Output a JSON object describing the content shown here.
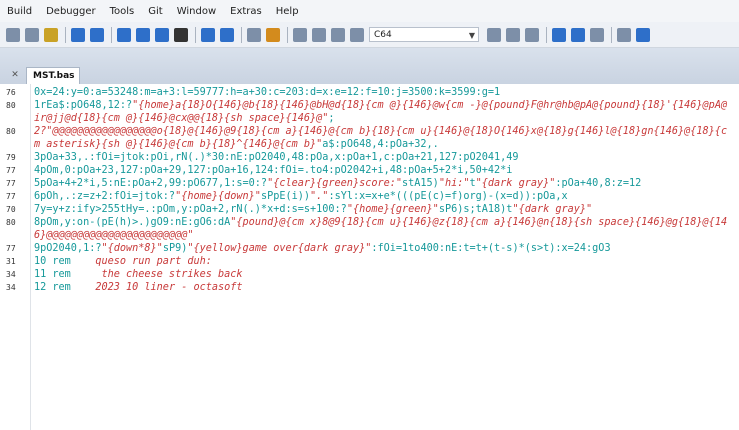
{
  "menubar": {
    "items": [
      "Build",
      "Debugger",
      "Tools",
      "Git",
      "Window",
      "Extras",
      "Help"
    ]
  },
  "toolbar": {
    "combo_value": "C64",
    "icons": [
      {
        "name": "cut-icon",
        "color": "#7d8fa8"
      },
      {
        "name": "copy-icon",
        "color": "#7d8fa8"
      },
      {
        "name": "paste-icon",
        "color": "#c9a227"
      },
      {
        "name": "list-icon",
        "color": "#2e6fc9"
      },
      {
        "name": "bulb-icon",
        "color": "#2e6fc9"
      },
      {
        "name": "run-icon",
        "color": "#2e6fc9"
      },
      {
        "name": "arrow-right-icon",
        "color": "#2e6fc9"
      },
      {
        "name": "minus-icon",
        "color": "#2e6fc9"
      },
      {
        "name": "close-icon",
        "color": "#333333"
      },
      {
        "name": "indent-icon",
        "color": "#2e6fc9"
      },
      {
        "name": "outdent-icon",
        "color": "#2e6fc9"
      },
      {
        "name": "comment-icon",
        "color": "#7d8fa8"
      },
      {
        "name": "bookmark-icon",
        "color": "#d38b1d"
      },
      {
        "name": "window-icon",
        "color": "#7d8fa8"
      },
      {
        "name": "window-split-icon",
        "color": "#7d8fa8"
      },
      {
        "name": "window-tile-icon",
        "color": "#7d8fa8"
      },
      {
        "name": "grid-icon",
        "color": "#7d8fa8"
      }
    ],
    "right_icons": [
      {
        "name": "table-icon",
        "color": "#7d8fa8"
      },
      {
        "name": "align-icon",
        "color": "#7d8fa8"
      },
      {
        "name": "columns-icon",
        "color": "#7d8fa8"
      },
      {
        "name": "stack-icon",
        "color": "#2e6fc9"
      },
      {
        "name": "format-icon",
        "color": "#2e6fc9"
      },
      {
        "name": "edit-icon",
        "color": "#7d8fa8"
      },
      {
        "name": "settings-icon",
        "color": "#7d8fa8"
      },
      {
        "name": "help-icon",
        "color": "#2e6fc9"
      }
    ]
  },
  "tab": {
    "label": "MST.bas"
  },
  "colors": {
    "code": "#16999a",
    "string": "#c83a3a"
  },
  "lines": [
    {
      "num": "76",
      "segs": [
        {
          "t": "c",
          "v": "0x=24:y=0:a=53248:m=a+3:l=59777:h=a+30:c=203:d=x:e=12:f=10:j=3500:k=3599:g=1"
        }
      ]
    },
    {
      "num": "80",
      "segs": [
        {
          "t": "c",
          "v": "1rEa$:pO648,12:?"
        },
        {
          "t": "s",
          "v": "\"{home}a{18}O{146}@b{18}{146}@bH@d{18}{cm @}{146}@w{cm -}@{pound}F@hr@hb@pA@{pound}{18}'{146}@pA@ir@jj@d{18}{cm @}{146}@cx@@{18}{sh space}{146}@\""
        },
        {
          "t": "c",
          "v": ";"
        }
      ]
    },
    {
      "num": "80",
      "segs": [
        {
          "t": "s",
          "v": "2?\"@@@@@@@@@@@@@@@@@o{18}@{146}@9{18}{cm a}{146}@{cm b}{18}{cm u}{146}@{18}O{146}x@{18}g{146}l@{18}gn{146}@{18}{cm asterisk}{sh @}{146}@{cm b}{18}^{146}@{cm b}\""
        },
        {
          "t": "c",
          "v": "a$:pO648,4:pOa+32,."
        }
      ]
    },
    {
      "num": "79",
      "segs": [
        {
          "t": "c",
          "v": "3pOa+33,.:fOi=jtok:pOi,rN(.)*30:nE:pO2040,48:pOa,x:pOa+1,c:pOa+21,127:pO2041,49"
        }
      ]
    },
    {
      "num": "77",
      "segs": [
        {
          "t": "c",
          "v": "4pOm,0:pOa+23,127:pOa+29,127:pOa+16,124:fOi=.to4:pO2042+i,48:pOa+5+2*i,50+42*i"
        }
      ]
    },
    {
      "num": "77",
      "segs": [
        {
          "t": "c",
          "v": "5pOa+4+2*i,5:nE:pOa+2,99:pO677,1:s=0:?"
        },
        {
          "t": "s",
          "v": "\"{clear}{green}score:\""
        },
        {
          "t": "c",
          "v": "stA15)"
        },
        {
          "t": "s",
          "v": "\"hi:\""
        },
        {
          "t": "c",
          "v": "t"
        },
        {
          "t": "s",
          "v": "\"{dark gray}\""
        },
        {
          "t": "c",
          "v": ":pOa+40,8:z=12"
        }
      ]
    },
    {
      "num": "77",
      "segs": [
        {
          "t": "c",
          "v": "6pOh,.:z=z+2:fOi=jtok:?"
        },
        {
          "t": "s",
          "v": "\"{home}{down}\""
        },
        {
          "t": "c",
          "v": "sPpE(i))"
        },
        {
          "t": "s",
          "v": "\".\""
        },
        {
          "t": "c",
          "v": ":sYl:x=x+e*(((pE(c)=f)org)-(x=d)):pOa,x"
        }
      ]
    },
    {
      "num": "70",
      "segs": [
        {
          "t": "c",
          "v": "7y=y+z:ify>255tHy=.:pOm,y:pOa+2,rN(.)*x+d:s=s+100:?"
        },
        {
          "t": "s",
          "v": "\"{home}{green}\""
        },
        {
          "t": "c",
          "v": "sP6)s;tA18)t"
        },
        {
          "t": "s",
          "v": "\"{dark gray}\""
        }
      ]
    },
    {
      "num": "80",
      "segs": [
        {
          "t": "c",
          "v": "8pOm,y:on-(pE(h)>.)gO9:nE:gO6:dA"
        },
        {
          "t": "s",
          "v": "\"{pound}@{cm x}8@9{18}{cm u}{146}@z{18}{cm a}{146}@n{18}{sh space}{146}@g{18}@{146}@@@@@@@@@@@@@@@@@@@@@@@\""
        }
      ]
    },
    {
      "num": "77",
      "segs": [
        {
          "t": "c",
          "v": "9pO2040,1:?"
        },
        {
          "t": "s",
          "v": "\"{down*8}\""
        },
        {
          "t": "c",
          "v": "sP9)"
        },
        {
          "t": "s",
          "v": "\"{yellow}game over{dark gray}\""
        },
        {
          "t": "c",
          "v": ":fOi=1to400:nE:t=t+(t-s)*(s>t):x=24:gO3"
        }
      ]
    },
    {
      "num": "31",
      "segs": [
        {
          "t": "c",
          "v": "10 rem    "
        },
        {
          "t": "r",
          "v": "queso run part duh:"
        }
      ]
    },
    {
      "num": "34",
      "segs": [
        {
          "t": "c",
          "v": "11 rem     "
        },
        {
          "t": "r",
          "v": "the cheese strikes back"
        }
      ]
    },
    {
      "num": "34",
      "segs": [
        {
          "t": "c",
          "v": "12 rem    "
        },
        {
          "t": "r",
          "v": "2023 10 liner - octasoft"
        }
      ]
    }
  ]
}
